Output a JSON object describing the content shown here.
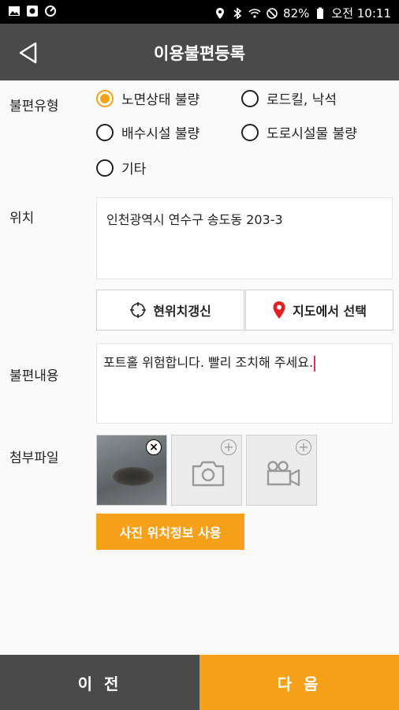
{
  "status_bar": {
    "battery": "82%",
    "time": "오전 10:11",
    "icons_left": [
      "gallery-icon",
      "sync-icon",
      "data-saver-icon"
    ],
    "icons_right": [
      "location-icon",
      "bluetooth-icon",
      "wifi-icon",
      "mute-icon",
      "battery-icon"
    ]
  },
  "app_bar": {
    "title": "이용불편등록",
    "back_icon": "back-arrow-icon"
  },
  "form": {
    "type_label": "불편유형",
    "options": [
      {
        "label": "노면상태 불량",
        "checked": true
      },
      {
        "label": "로드킬, 낙석",
        "checked": false
      },
      {
        "label": "배수시설 불량",
        "checked": false
      },
      {
        "label": "도로시설물 불량",
        "checked": false
      },
      {
        "label": "기타",
        "checked": false
      }
    ],
    "location_label": "위치",
    "location_value": "인천광역시 연수구 송도동 203-3",
    "refresh_location_label": "현위치갱신",
    "select_on_map_label": "지도에서 선택",
    "content_label": "불편내용",
    "content_value": "포트홀 위험합니다. 빨리 조치해 주세요.",
    "attachment_label": "첨부파일",
    "use_photo_location_label": "사진 위치정보 사용"
  },
  "bottom": {
    "prev_label": "이 전",
    "next_label": "다 음"
  },
  "colors": {
    "accent": "#f7a11a",
    "app_bar": "#4a4a4a",
    "pin": "#e02020"
  }
}
